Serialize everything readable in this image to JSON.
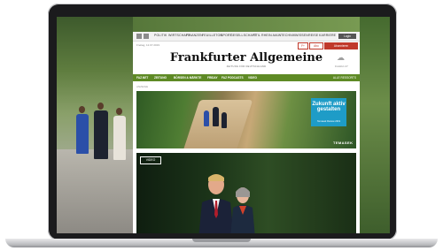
{
  "site": {
    "logo": "Frankfurter Allgemeine",
    "tagline": "ZEITUNG FÜR DEUTSCHLAND",
    "date_row": "Freitag, 12.07.2019",
    "weather_temp": "Frankfurt 21°"
  },
  "top_nav": [
    "POLITIK",
    "WIRTSCHAFT",
    "FINANZEN",
    "FEUILLETON",
    "SPORT",
    "GESELLSCHAFT",
    "STIL",
    "RHEIN-MAIN",
    "TECHNIK",
    "WISSEN",
    "REISE",
    "KARRIERE"
  ],
  "login_label": "Login",
  "buttons": {
    "plus": "F+",
    "abo": "Abo",
    "subscribe": "Abonnieren"
  },
  "green_nav": [
    "FAZ.NET",
    "ZEITUNG",
    "BÖRSEN & MÄRKTE",
    "FRIDAY",
    "FAZ PODCASTS",
    "VIDEO"
  ],
  "green_nav_right": "ALLE RESSORTS",
  "breadcrumb": "ANZEIGE",
  "ad": {
    "line1": "Zukunft aktiv gestalten",
    "line2": "Temasek Review 2019",
    "brand": "TEMASEK"
  },
  "hero": {
    "badge": "VIDEO"
  }
}
